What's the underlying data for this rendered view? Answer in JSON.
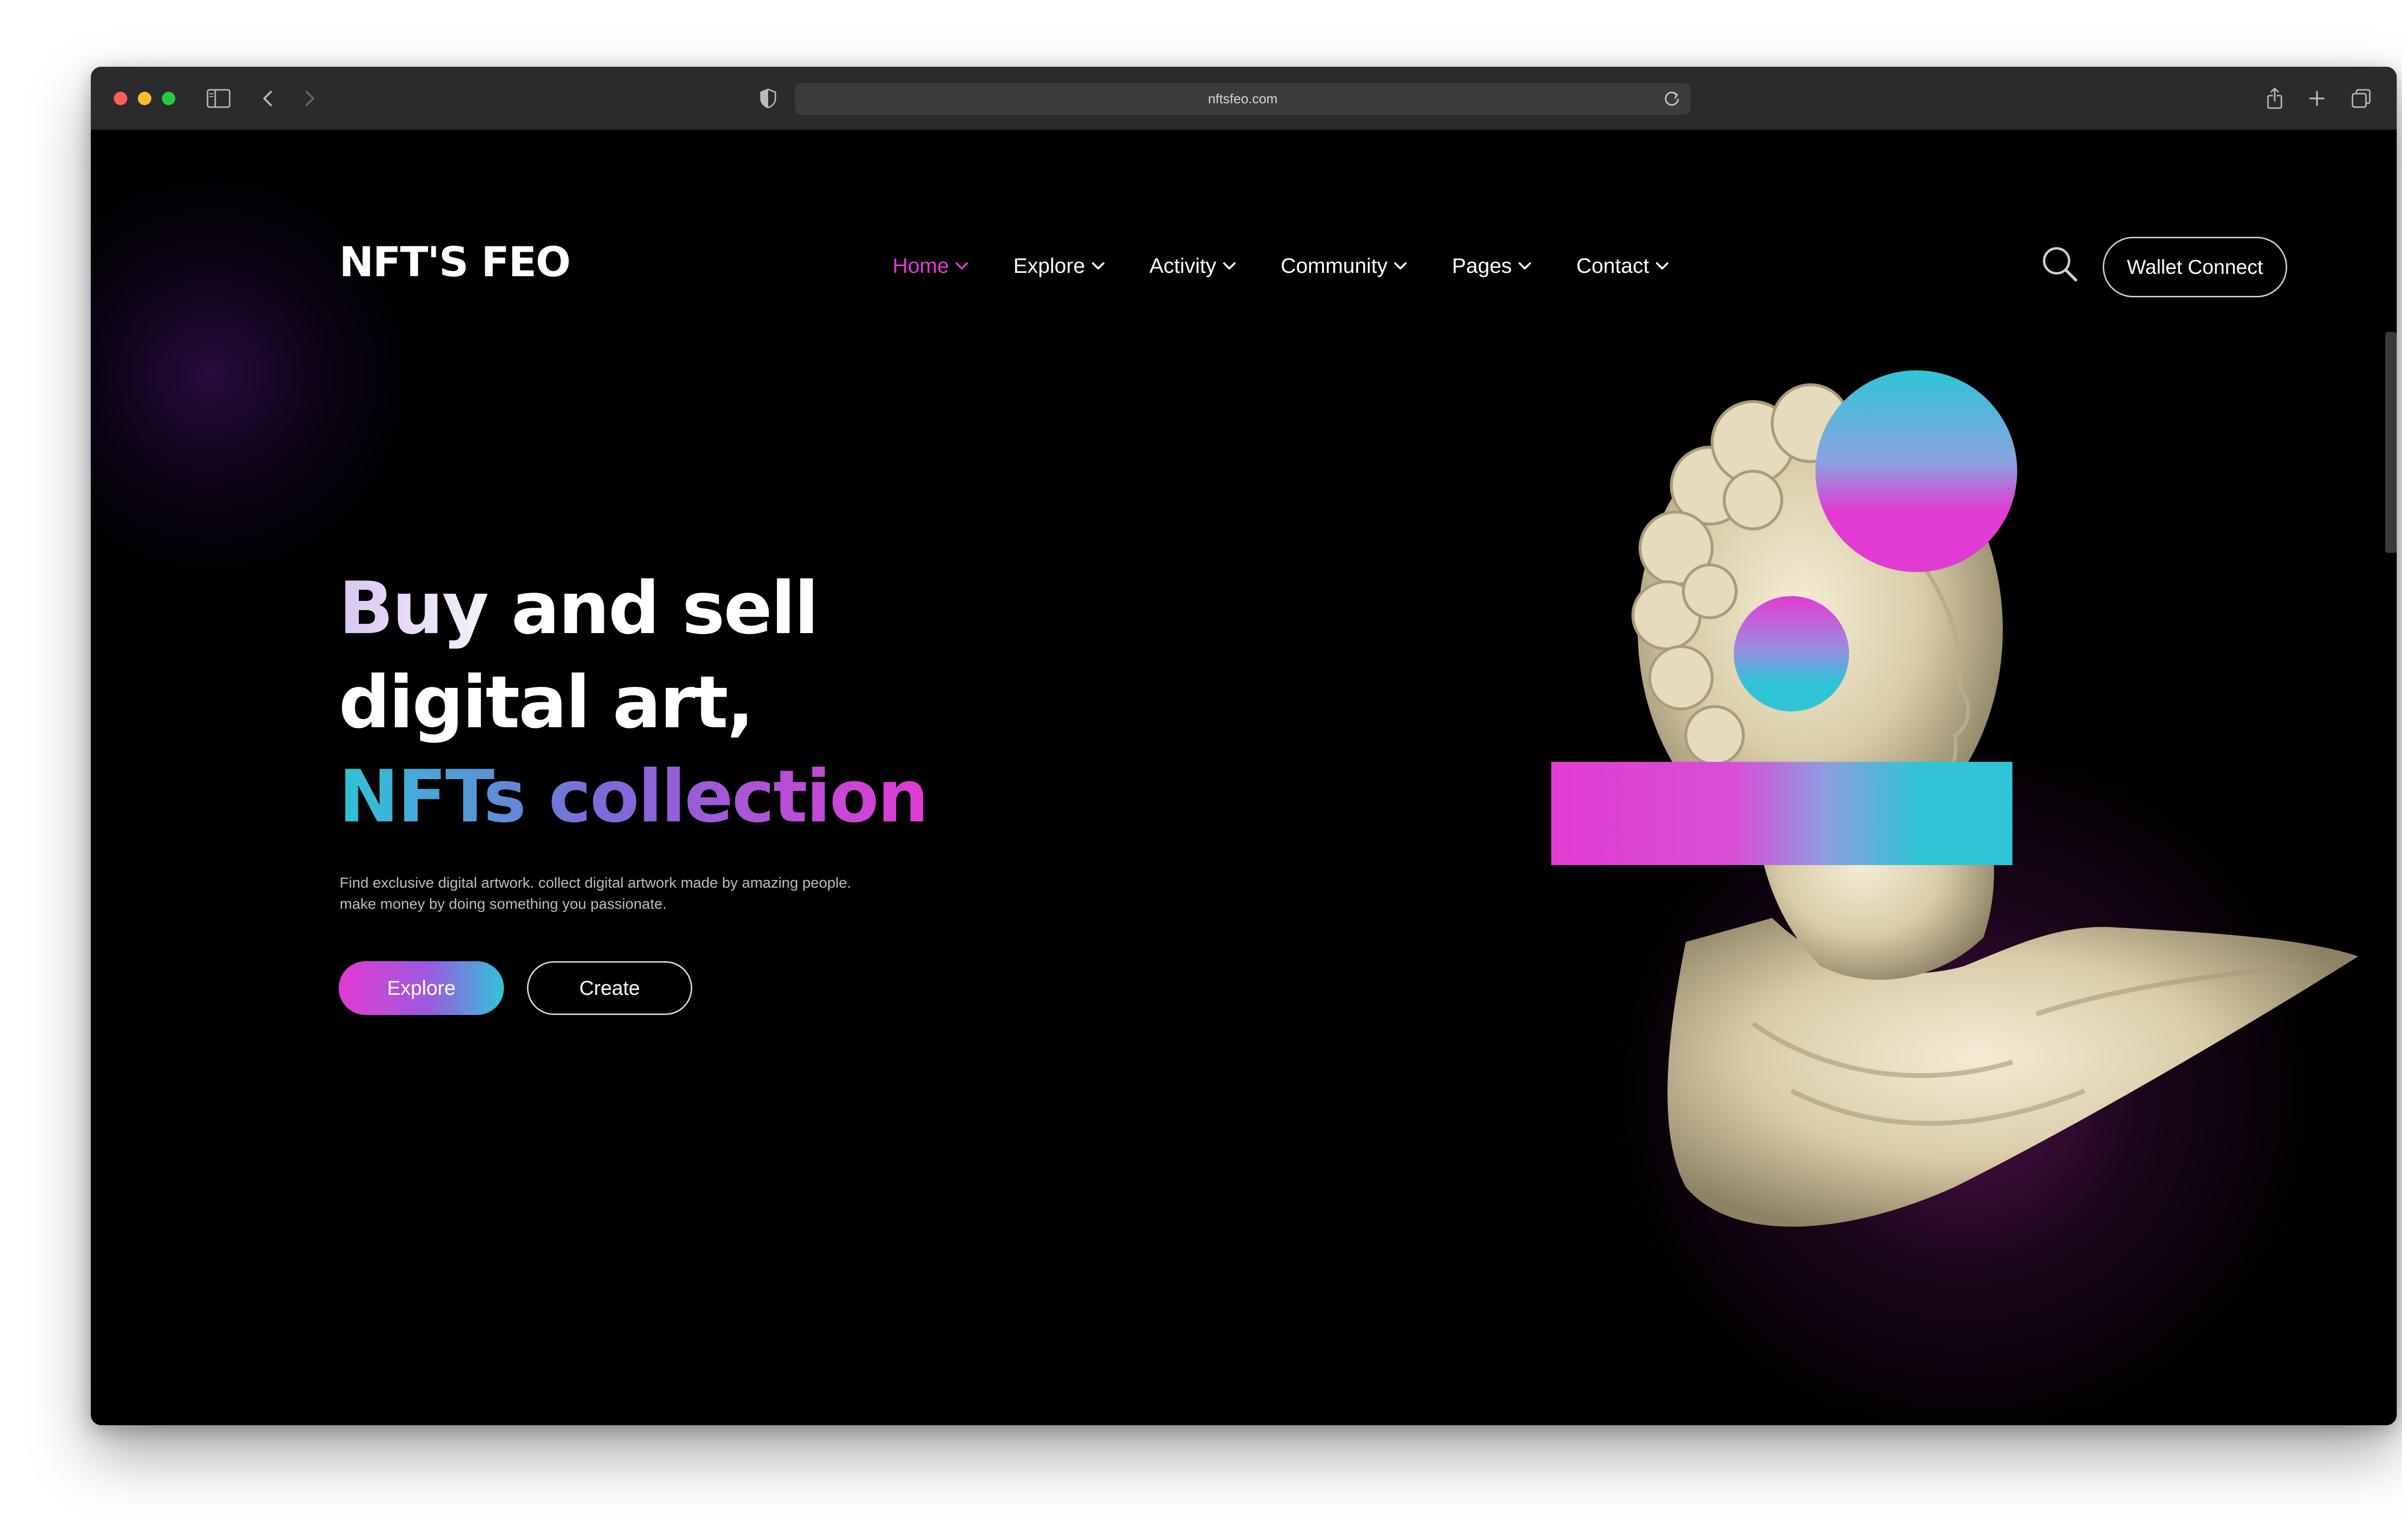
{
  "browser": {
    "url": "nftsfeo.com",
    "icons": [
      "sidebar-icon",
      "back-icon",
      "forward-icon",
      "shield-icon",
      "reload-icon",
      "share-icon",
      "new-tab-icon",
      "tabs-icon"
    ]
  },
  "brand": {
    "logo": "NFT'S FEO"
  },
  "nav": {
    "items": [
      {
        "label": "Home",
        "active": true
      },
      {
        "label": "Explore",
        "active": false
      },
      {
        "label": "Activity",
        "active": false
      },
      {
        "label": "Community",
        "active": false
      },
      {
        "label": "Pages",
        "active": false
      },
      {
        "label": "Contact",
        "active": false
      }
    ],
    "wallet_label": "Wallet Connect"
  },
  "hero": {
    "title_line1": "Buy and sell",
    "title_line2": "digital art,",
    "title_line3": "NFTs collection",
    "description_line1": "Find exclusive digital artwork. collect digital artwork made by amazing people.",
    "description_line2": "make money by doing something you passionate.",
    "explore_label": "Explore",
    "create_label": "Create"
  },
  "colors": {
    "accent_pink": "#e23bd3",
    "accent_cyan": "#2fc4d6",
    "background": "#000000"
  }
}
